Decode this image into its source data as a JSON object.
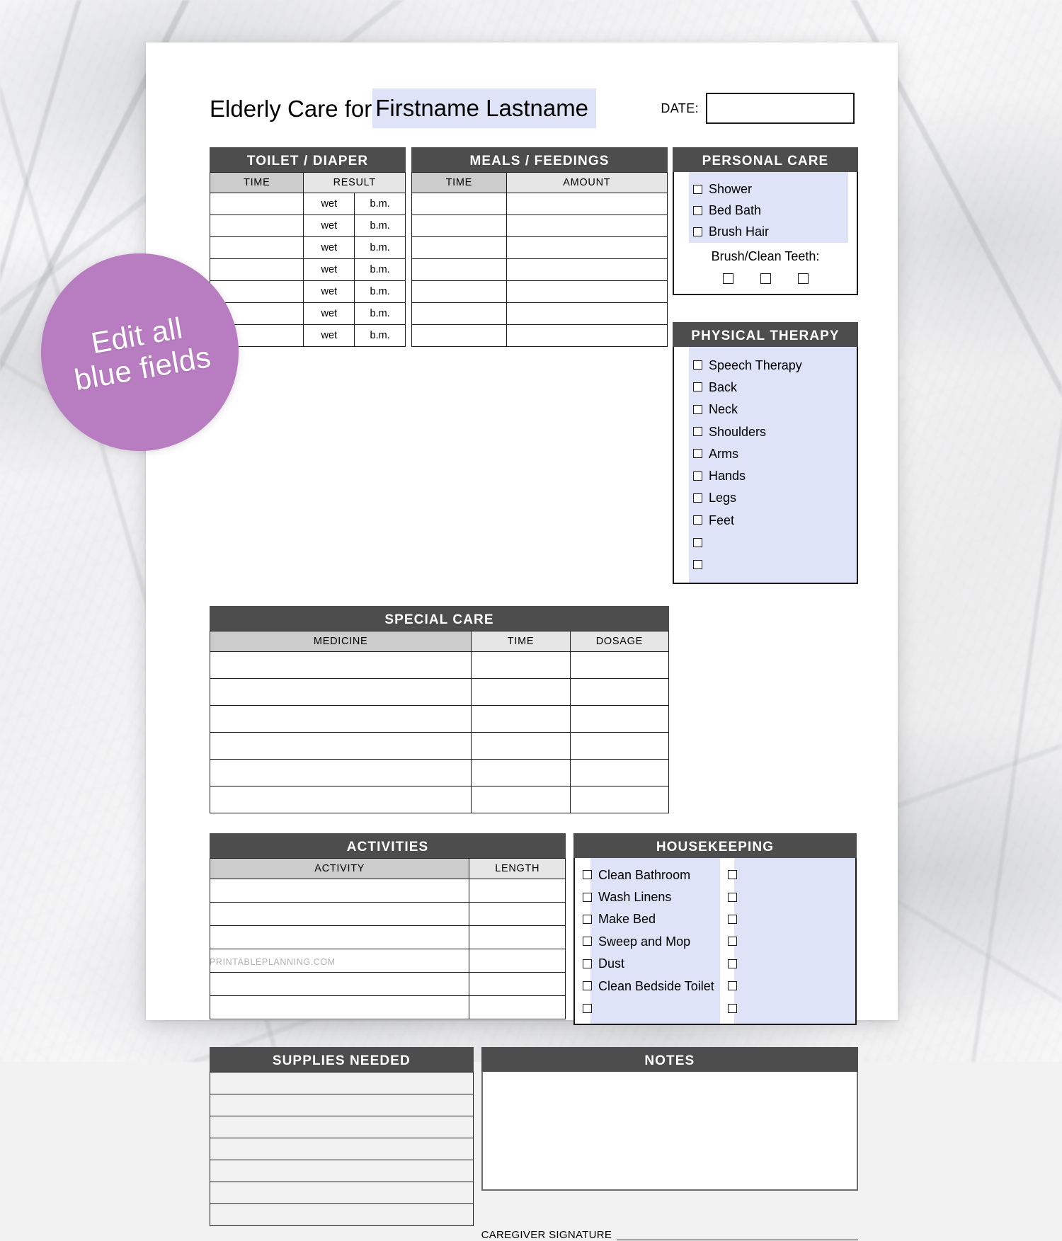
{
  "page": {
    "title_static": "Elderly Care for ",
    "title_field": "Firstname Lastname",
    "date_label": "DATE:",
    "date_value": "",
    "watermark": "PRINTABLEPLANNING.COM",
    "signature_label": "CAREGIVER SIGNATURE"
  },
  "badge": {
    "text": "Edit all\nblue fields",
    "color": "#b87cc0"
  },
  "colors": {
    "header_bar": "#4d4d4d",
    "subheader": "#cccccc",
    "subheader_light": "#e6e6e6",
    "blue_field": "#dee3f8",
    "border": "#1a1a1a",
    "paper": "#ffffff"
  },
  "toilet_diaper": {
    "title": "TOILET / DIAPER",
    "columns": [
      "TIME",
      "RESULT"
    ],
    "result_sub": [
      "wet",
      "b.m."
    ],
    "row_count": 7,
    "rows": [
      {
        "time": "",
        "wet": "wet",
        "bm": "b.m."
      },
      {
        "time": "",
        "wet": "wet",
        "bm": "b.m."
      },
      {
        "time": "",
        "wet": "wet",
        "bm": "b.m."
      },
      {
        "time": "",
        "wet": "wet",
        "bm": "b.m."
      },
      {
        "time": "",
        "wet": "wet",
        "bm": "b.m."
      },
      {
        "time": "",
        "wet": "wet",
        "bm": "b.m."
      },
      {
        "time": "",
        "wet": "wet",
        "bm": "b.m."
      }
    ]
  },
  "meals_feedings": {
    "title": "MEALS / FEEDINGS",
    "columns": [
      "TIME",
      "AMOUNT"
    ],
    "row_count": 7,
    "rows": [
      {
        "time": "",
        "amount": ""
      },
      {
        "time": "",
        "amount": ""
      },
      {
        "time": "",
        "amount": ""
      },
      {
        "time": "",
        "amount": ""
      },
      {
        "time": "",
        "amount": ""
      },
      {
        "time": "",
        "amount": ""
      },
      {
        "time": "",
        "amount": ""
      }
    ]
  },
  "personal_care": {
    "title": "PERSONAL CARE",
    "items": [
      {
        "label": "Shower",
        "checked": false
      },
      {
        "label": "Bed Bath",
        "checked": false
      },
      {
        "label": "Brush Hair",
        "checked": false
      }
    ],
    "teeth_label": "Brush/Clean Teeth:",
    "teeth_boxes": 3
  },
  "physical_therapy": {
    "title": "PHYSICAL THERAPY",
    "items": [
      {
        "label": "Speech Therapy",
        "checked": false
      },
      {
        "label": "Back",
        "checked": false
      },
      {
        "label": "Neck",
        "checked": false
      },
      {
        "label": "Shoulders",
        "checked": false
      },
      {
        "label": "Arms",
        "checked": false
      },
      {
        "label": "Hands",
        "checked": false
      },
      {
        "label": "Legs",
        "checked": false
      },
      {
        "label": "Feet",
        "checked": false
      },
      {
        "label": "",
        "checked": false
      },
      {
        "label": "",
        "checked": false
      }
    ]
  },
  "special_care": {
    "title": "SPECIAL CARE",
    "columns": [
      "MEDICINE",
      "TIME",
      "DOSAGE"
    ],
    "row_count": 6,
    "rows": [
      {
        "medicine": "",
        "time": "",
        "dosage": ""
      },
      {
        "medicine": "",
        "time": "",
        "dosage": ""
      },
      {
        "medicine": "",
        "time": "",
        "dosage": ""
      },
      {
        "medicine": "",
        "time": "",
        "dosage": ""
      },
      {
        "medicine": "",
        "time": "",
        "dosage": ""
      },
      {
        "medicine": "",
        "time": "",
        "dosage": ""
      }
    ]
  },
  "activities": {
    "title": "ACTIVITIES",
    "columns": [
      "ACTIVITY",
      "LENGTH"
    ],
    "row_count": 6,
    "rows": [
      {
        "activity": "",
        "length": ""
      },
      {
        "activity": "",
        "length": ""
      },
      {
        "activity": "",
        "length": ""
      },
      {
        "activity": "",
        "length": ""
      },
      {
        "activity": "",
        "length": ""
      },
      {
        "activity": "",
        "length": ""
      }
    ]
  },
  "housekeeping": {
    "title": "HOUSEKEEPING",
    "left_items": [
      {
        "label": "Clean Bathroom",
        "checked": false
      },
      {
        "label": "Wash Linens",
        "checked": false
      },
      {
        "label": "Make Bed",
        "checked": false
      },
      {
        "label": "Sweep and Mop",
        "checked": false
      },
      {
        "label": "Dust",
        "checked": false
      },
      {
        "label": "Clean Bedside Toilet",
        "checked": false
      },
      {
        "label": "",
        "checked": false
      }
    ],
    "right_items": [
      {
        "label": "",
        "checked": false
      },
      {
        "label": "",
        "checked": false
      },
      {
        "label": "",
        "checked": false
      },
      {
        "label": "",
        "checked": false
      },
      {
        "label": "",
        "checked": false
      },
      {
        "label": "",
        "checked": false
      },
      {
        "label": "",
        "checked": false
      }
    ]
  },
  "supplies_needed": {
    "title": "SUPPLIES NEEDED",
    "row_count": 7,
    "rows": [
      "",
      "",
      "",
      "",
      "",
      "",
      ""
    ]
  },
  "notes": {
    "title": "NOTES",
    "value": ""
  }
}
